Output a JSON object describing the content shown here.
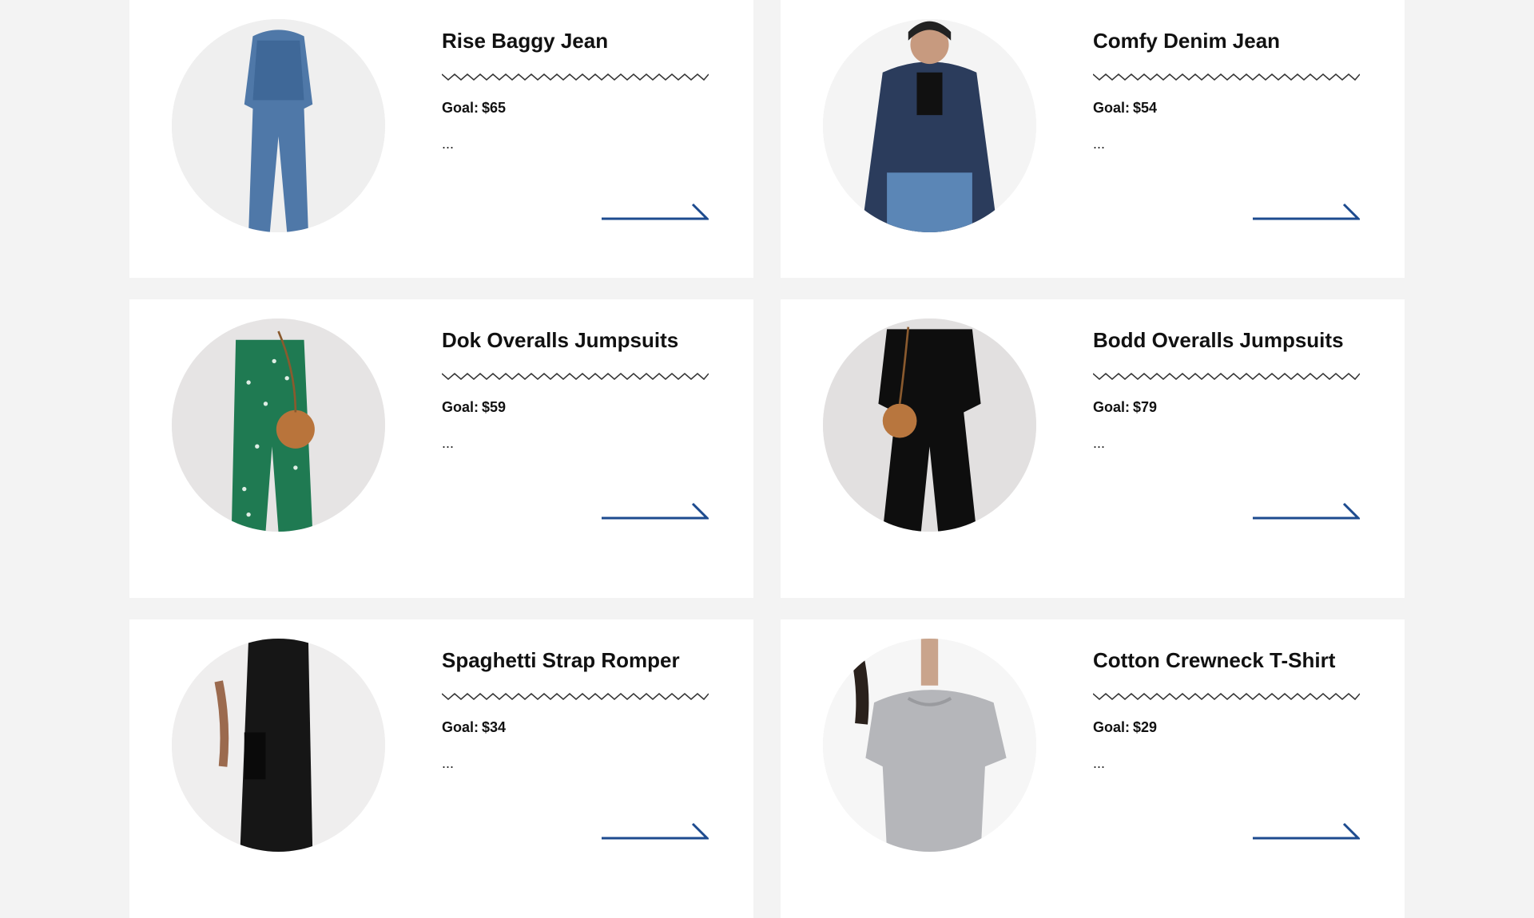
{
  "theme": {
    "accent": "#1d4b8f",
    "background": "#f3f3f3",
    "card": "#ffffff"
  },
  "products": [
    {
      "title": "Rise Baggy Jean",
      "goal_label": "Goal:",
      "goal_value": "$65",
      "description": "...",
      "image_icon": "denim-outfit-image",
      "arrow_icon": "arrow-right-icon"
    },
    {
      "title": "Comfy Denim Jean",
      "goal_label": "Goal:",
      "goal_value": "$54",
      "description": "...",
      "image_icon": "denim-shirt-image",
      "arrow_icon": "arrow-right-icon"
    },
    {
      "title": "Dok Overalls Jumpsuits",
      "goal_label": "Goal:",
      "goal_value": "$59",
      "description": "...",
      "image_icon": "green-jumpsuit-image",
      "arrow_icon": "arrow-right-icon"
    },
    {
      "title": "Bodd Overalls Jumpsuits",
      "goal_label": "Goal:",
      "goal_value": "$79",
      "description": "...",
      "image_icon": "black-jumpsuit-image",
      "arrow_icon": "arrow-right-icon"
    },
    {
      "title": "Spaghetti Strap Romper",
      "goal_label": "Goal:",
      "goal_value": "$34",
      "description": "...",
      "image_icon": "black-romper-image",
      "arrow_icon": "arrow-right-icon"
    },
    {
      "title": "Cotton Crewneck T-Shirt",
      "goal_label": "Goal:",
      "goal_value": "$29",
      "description": "...",
      "image_icon": "grey-tshirt-image",
      "arrow_icon": "arrow-right-icon"
    }
  ]
}
